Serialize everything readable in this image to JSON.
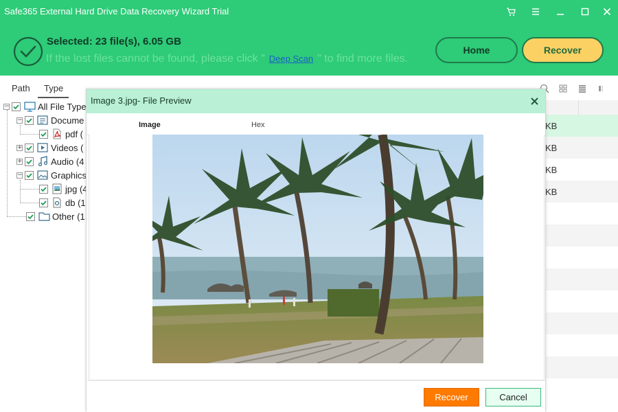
{
  "window": {
    "title": "Safe365 External Hard Drive Data Recovery Wizard Trial",
    "controls": [
      "cart-icon",
      "menu-icon",
      "minimize-icon",
      "maximize-icon",
      "close-icon"
    ]
  },
  "header": {
    "selected": "Selected: 23 file(s), 6.05 GB",
    "hint_before": "If the lost files cannot be found, please click \"",
    "deep_scan": "Deep Scan",
    "hint_after": "\" to find more files.",
    "home_label": "Home",
    "recover_label": "Recover"
  },
  "left_panel": {
    "tabs": [
      "Path",
      "Type"
    ],
    "active_tab": "Type",
    "tree": [
      {
        "label": "All File Type",
        "icon": "monitor-icon"
      },
      {
        "label": "Docume",
        "icon": "document-icon"
      },
      {
        "label": "pdf (",
        "icon": "pdf-icon"
      },
      {
        "label": "Videos (",
        "icon": "video-icon"
      },
      {
        "label": "Audio (4",
        "icon": "music-icon"
      },
      {
        "label": "Graphics",
        "icon": "image-icon"
      },
      {
        "label": "jpg (4",
        "icon": "jpg-file-icon"
      },
      {
        "label": "db (1",
        "icon": "db-file-icon"
      },
      {
        "label": "Other (1",
        "icon": "folder-icon"
      }
    ]
  },
  "file_table": {
    "rows": [
      "KB",
      "KB",
      "KB",
      "KB"
    ]
  },
  "preview": {
    "title": "Image 3.jpg- File Preview",
    "tabs": [
      "Image",
      "Hex"
    ],
    "recover_label": "Recover",
    "cancel_label": "Cancel",
    "colors": {
      "accent": "#2ecb78",
      "recover": "#ff7a00",
      "title_bar": "#b9f0d6"
    }
  }
}
